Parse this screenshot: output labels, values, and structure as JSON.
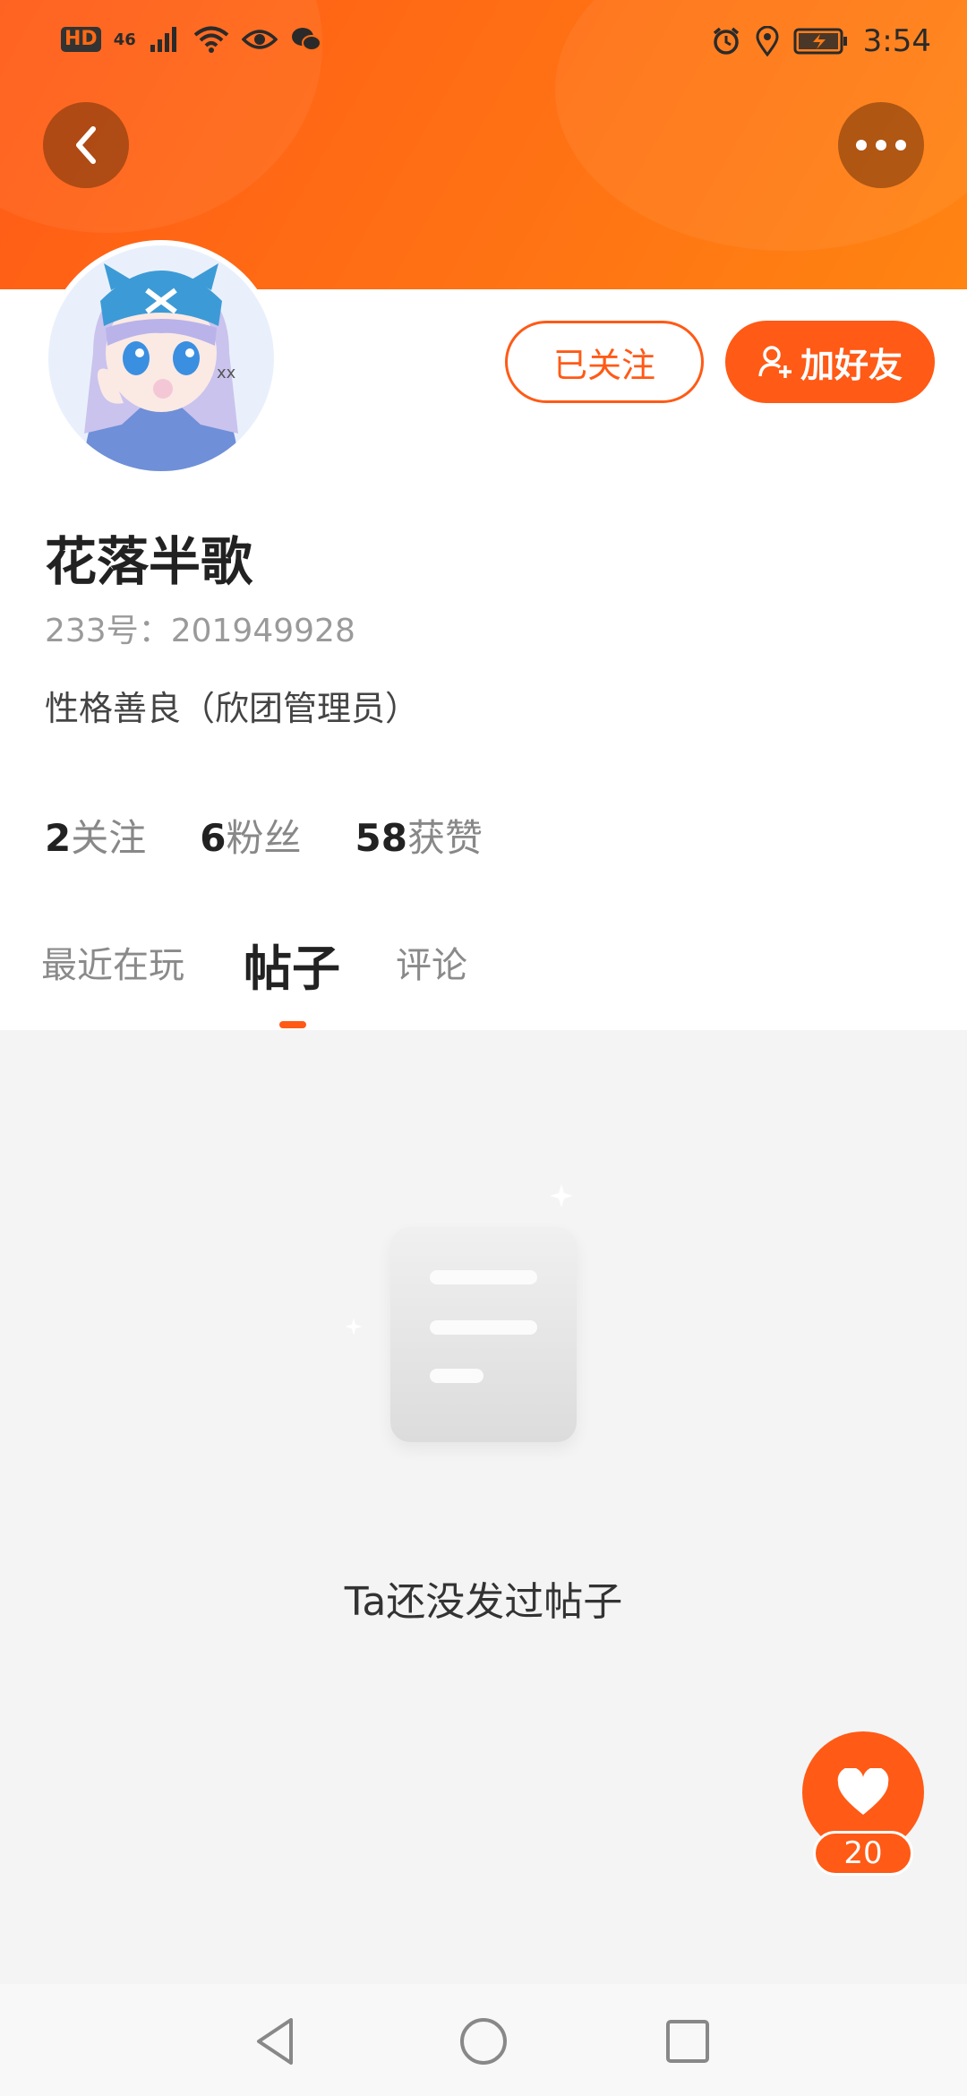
{
  "status_bar": {
    "hd": "HD",
    "network": "46",
    "time": "3:54"
  },
  "header": {
    "back_icon": "chevron-left-icon",
    "more_icon": "more-dots-icon",
    "accent_color": "#ff5a16"
  },
  "profile": {
    "name": "花落半歌",
    "uid": "233号：201949928",
    "bio": "性格善良（欣团管理员）",
    "follow_button": "已关注",
    "add_friend_button": "加好友"
  },
  "stats": [
    {
      "count": "2",
      "label": "关注"
    },
    {
      "count": "6",
      "label": "粉丝"
    },
    {
      "count": "58",
      "label": "获赞"
    }
  ],
  "tabs": [
    {
      "label": "最近在玩",
      "active": false
    },
    {
      "label": "帖子",
      "active": true
    },
    {
      "label": "评论",
      "active": false
    }
  ],
  "empty_state": {
    "message": "Ta还没发过帖子"
  },
  "like": {
    "count": "20"
  }
}
